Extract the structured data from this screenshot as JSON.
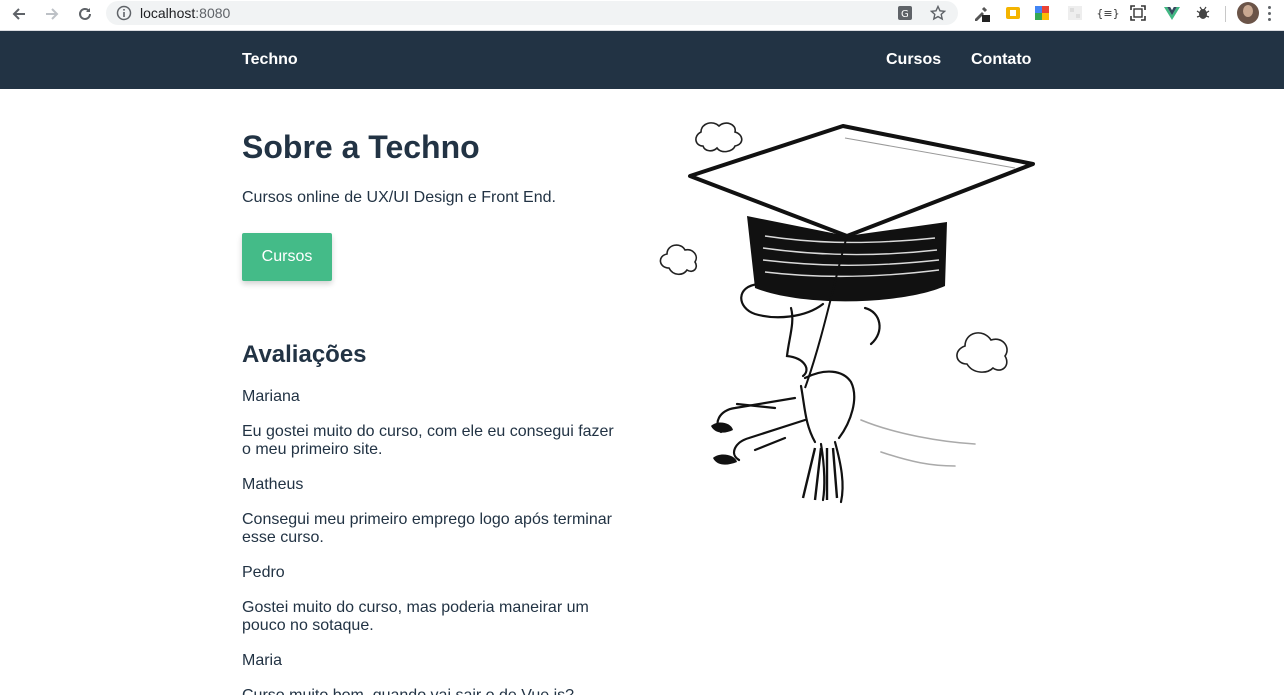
{
  "browser": {
    "url_host": "localhost",
    "url_port": ":8080",
    "back_icon": "arrow-left-icon",
    "forward_icon": "arrow-right-icon",
    "reload_icon": "reload-icon",
    "info_icon": "info-icon",
    "translate_icon": "translate-icon",
    "bookmark_icon": "star-icon",
    "extensions": [
      "eyedropper-icon",
      "extension-orange-icon",
      "extension-google-icon",
      "extension-grid-icon",
      "json-viewer-icon",
      "screenshot-icon",
      "vue-devtools-icon",
      "bug-icon"
    ],
    "json_label": "{≡}"
  },
  "header": {
    "logo": "Techno",
    "nav": [
      {
        "label": "Cursos"
      },
      {
        "label": "Contato"
      }
    ]
  },
  "main": {
    "title": "Sobre a Techno",
    "subtitle": "Cursos online de UX/UI Design e Front End.",
    "cta_label": "Cursos",
    "reviews_title": "Avaliações",
    "reviews": [
      {
        "name": "Mariana",
        "text": "Eu gostei muito do curso, com ele eu consegui fazer o meu primeiro site."
      },
      {
        "name": "Matheus",
        "text": "Consegui meu primeiro emprego logo após terminar esse curso."
      },
      {
        "name": "Pedro",
        "text": "Gostei muito do curso, mas poderia maneirar um pouco no sotaque."
      },
      {
        "name": "Maria",
        "text": "Curso muito bom, quando vai sair o de Vue.js?"
      }
    ]
  },
  "colors": {
    "header_bg": "#223344",
    "accent": "#44bb88",
    "text": "#223344"
  }
}
